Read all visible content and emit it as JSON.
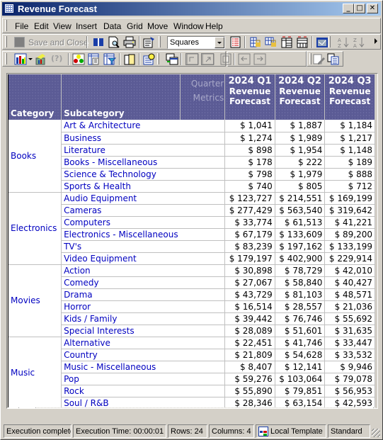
{
  "window": {
    "title": "Revenue Forecast",
    "controls": {
      "minimize": "_",
      "maximize": "□",
      "close": "✕"
    }
  },
  "menu": {
    "items": [
      "File",
      "Edit",
      "View",
      "Insert",
      "Data",
      "Grid",
      "Move",
      "Window",
      "Help"
    ]
  },
  "toolbar1": {
    "save_close_label": "Save and Close",
    "style_combo_value": "Squares",
    "icons": [
      "save-icon",
      "open-book-icon",
      "print-preview-icon",
      "print-icon",
      "properties-icon",
      "list-icon",
      "lock-rows-icon",
      "lock-columns-icon",
      "grid-layout-icon",
      "grid-table-icon",
      "export-icon",
      "sort-ascending-icon",
      "sort-descending-icon"
    ]
  },
  "toolbar2": {
    "icons": [
      "chart-icon",
      "graph-wizard-icon",
      "help-question-icon",
      "shapes-icon",
      "report-icon",
      "filter-icon",
      "page-icon",
      "schedule-icon",
      "multi-window-icon",
      "pivot-icon",
      "swap-icon",
      "calculator-icon",
      "left-arrow-icon",
      "right-arrow-icon",
      "edit-icon",
      "copy-icon"
    ]
  },
  "grid": {
    "headers": {
      "category": "Category",
      "subcategory": "Subcategory",
      "attribute_row1": "Quarter",
      "attribute_row2": "Metrics",
      "columns": [
        {
          "quarter": "2024 Q1",
          "metric_line1": "Revenue",
          "metric_line2": "Forecast"
        },
        {
          "quarter": "2024 Q2",
          "metric_line1": "Revenue",
          "metric_line2": "Forecast"
        },
        {
          "quarter": "2024 Q3",
          "metric_line1": "Revenue",
          "metric_line2": "Forecast"
        }
      ]
    },
    "groups": [
      {
        "category": "Books",
        "rows": [
          {
            "sub": "Art & Architecture",
            "q1": "$ 1,041",
            "q2": "$ 1,887",
            "q3": "$ 1,184"
          },
          {
            "sub": "Business",
            "q1": "$ 1,274",
            "q2": "$ 1,989",
            "q3": "$ 1,217"
          },
          {
            "sub": "Literature",
            "q1": "$ 898",
            "q2": "$ 1,954",
            "q3": "$ 1,148"
          },
          {
            "sub": "Books - Miscellaneous",
            "q1": "$ 178",
            "q2": "$ 222",
            "q3": "$ 189"
          },
          {
            "sub": "Science & Technology",
            "q1": "$ 798",
            "q2": "$ 1,979",
            "q3": "$ 888"
          },
          {
            "sub": "Sports & Health",
            "q1": "$ 740",
            "q2": "$ 805",
            "q3": "$ 712"
          }
        ]
      },
      {
        "category": "Electronics",
        "rows": [
          {
            "sub": "Audio Equipment",
            "q1": "$ 123,727",
            "q2": "$ 214,551",
            "q3": "$ 169,199"
          },
          {
            "sub": "Cameras",
            "q1": "$ 277,429",
            "q2": "$ 563,540",
            "q3": "$ 319,642"
          },
          {
            "sub": "Computers",
            "q1": "$ 33,774",
            "q2": "$ 61,513",
            "q3": "$ 41,221"
          },
          {
            "sub": "Electronics - Miscellaneous",
            "q1": "$ 67,179",
            "q2": "$ 133,609",
            "q3": "$ 89,200"
          },
          {
            "sub": "TV's",
            "q1": "$ 83,239",
            "q2": "$ 197,162",
            "q3": "$ 133,199"
          },
          {
            "sub": "Video Equipment",
            "q1": "$ 179,197",
            "q2": "$ 402,900",
            "q3": "$ 229,914"
          }
        ]
      },
      {
        "category": "Movies",
        "rows": [
          {
            "sub": "Action",
            "q1": "$ 30,898",
            "q2": "$ 78,729",
            "q3": "$ 42,010"
          },
          {
            "sub": "Comedy",
            "q1": "$ 27,067",
            "q2": "$ 58,840",
            "q3": "$ 40,427"
          },
          {
            "sub": "Drama",
            "q1": "$ 43,729",
            "q2": "$ 81,103",
            "q3": "$ 48,571"
          },
          {
            "sub": "Horror",
            "q1": "$ 16,514",
            "q2": "$ 28,557",
            "q3": "$ 21,036"
          },
          {
            "sub": "Kids / Family",
            "q1": "$ 39,442",
            "q2": "$ 76,746",
            "q3": "$ 55,692"
          },
          {
            "sub": "Special Interests",
            "q1": "$ 28,089",
            "q2": "$ 51,601",
            "q3": "$ 31,635"
          }
        ]
      },
      {
        "category": "Music",
        "rows": [
          {
            "sub": "Alternative",
            "q1": "$ 22,451",
            "q2": "$ 41,746",
            "q3": "$ 33,447"
          },
          {
            "sub": "Country",
            "q1": "$ 21,809",
            "q2": "$ 54,628",
            "q3": "$ 33,532"
          },
          {
            "sub": "Music - Miscellaneous",
            "q1": "$ 8,407",
            "q2": "$ 12,141",
            "q3": "$ 9,946"
          },
          {
            "sub": "Pop",
            "q1": "$ 59,276",
            "q2": "$ 103,064",
            "q3": "$ 79,078"
          },
          {
            "sub": "Rock",
            "q1": "$ 55,890",
            "q2": "$ 79,851",
            "q3": "$ 56,953"
          },
          {
            "sub": "Soul / R&B",
            "q1": "$ 28,346",
            "q2": "$ 63,154",
            "q3": "$ 42,593"
          }
        ]
      }
    ]
  },
  "statusbar": {
    "execution": "Execution complete",
    "execution_time": "Execution Time: 00:00:01",
    "rows": "Rows: 24",
    "columns": "Columns: 4",
    "template": "Local Template",
    "style": "Standard"
  },
  "colors": {
    "header_bg": "#5b5b95",
    "link_text": "#0000c0",
    "title_gradient_start": "#0a246a",
    "title_gradient_end": "#a6caf0"
  }
}
